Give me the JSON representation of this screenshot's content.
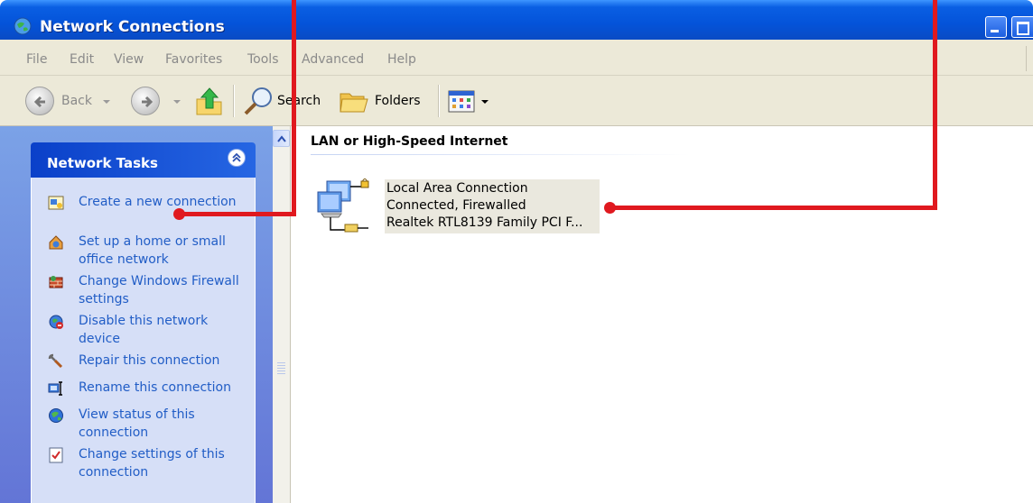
{
  "window": {
    "title": "Network Connections"
  },
  "menu": [
    "File",
    "Edit",
    "View",
    "Favorites",
    "Tools",
    "Advanced",
    "Help"
  ],
  "toolbar": {
    "back_label": "Back",
    "search_label": "Search",
    "folders_label": "Folders"
  },
  "task_pane": {
    "title": "Network Tasks",
    "tasks": [
      {
        "label": "Create a new connection",
        "icon": "new-connection-icon"
      },
      {
        "label": "Set up a home or small office network",
        "icon": "home-network-icon"
      },
      {
        "label": "Change Windows Firewall settings",
        "icon": "firewall-icon"
      },
      {
        "label": "Disable this network device",
        "icon": "disable-device-icon"
      },
      {
        "label": "Repair this connection",
        "icon": "repair-icon"
      },
      {
        "label": "Rename this connection",
        "icon": "rename-icon"
      },
      {
        "label": "View status of this connection",
        "icon": "status-icon"
      },
      {
        "label": "Change settings of this connection",
        "icon": "settings-icon"
      }
    ]
  },
  "content": {
    "group_header": "LAN or High-Speed Internet",
    "connection": {
      "name": "Local Area Connection",
      "status": "Connected, Firewalled",
      "device": "Realtek RTL8139 Family PCI F..."
    }
  },
  "colors": {
    "link": "#215dc6",
    "callout": "#e0191f",
    "titlebar": "#0453d9"
  }
}
